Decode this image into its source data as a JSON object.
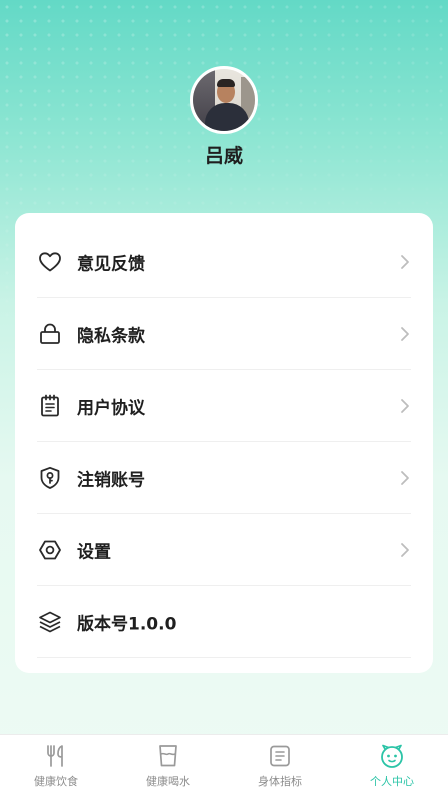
{
  "profile": {
    "name": "吕威",
    "avatar_alt": "avatar"
  },
  "menu": [
    {
      "label": "意见反馈",
      "icon": "heart-icon",
      "chevron": true
    },
    {
      "label": "隐私条款",
      "icon": "lock-icon",
      "chevron": true
    },
    {
      "label": "用户协议",
      "icon": "document-icon",
      "chevron": true
    },
    {
      "label": "注销账号",
      "icon": "shield-key-icon",
      "chevron": true
    },
    {
      "label": "设置",
      "icon": "hexagon-settings-icon",
      "chevron": true
    },
    {
      "label": "版本号1.0.0",
      "icon": "layers-icon",
      "chevron": false
    }
  ],
  "tabbar": {
    "tabs": [
      {
        "label": "健康饮食",
        "icon": "fork-knife-icon",
        "active": false
      },
      {
        "label": "健康喝水",
        "icon": "cup-icon",
        "active": false
      },
      {
        "label": "身体指标",
        "icon": "body-metrics-icon",
        "active": false
      },
      {
        "label": "个人中心",
        "icon": "smiley-face-icon",
        "active": true
      }
    ]
  },
  "colors": {
    "accent": "#2cc4a7",
    "inactive": "#8c8c8c",
    "text": "#1f1f1f"
  }
}
